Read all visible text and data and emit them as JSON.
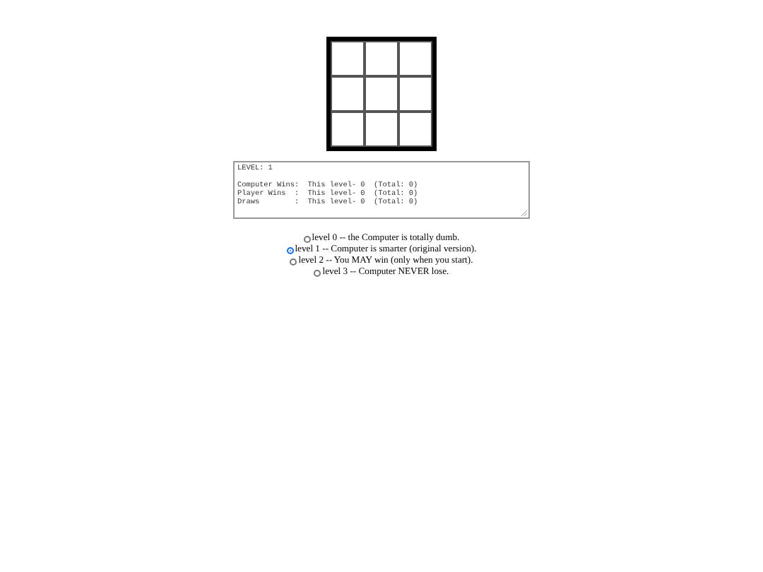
{
  "stats_box": {
    "header": "LEVEL: 1",
    "lines": [
      "Computer Wins:  This level- 0  (Total: 0)",
      "Player Wins  :  This level- 0  (Total: 0)",
      "Draws        :  This level- 0  (Total: 0)"
    ]
  },
  "levels": [
    {
      "label": "level 0 -- the Computer is totally dumb.",
      "selected": false
    },
    {
      "label": "level 1 -- Computer is smarter (original version).",
      "selected": true
    },
    {
      "label": "level 2 -- You MAY win (only when you start).",
      "selected": false
    },
    {
      "label": "level 3 -- Computer NEVER lose.",
      "selected": false
    }
  ]
}
